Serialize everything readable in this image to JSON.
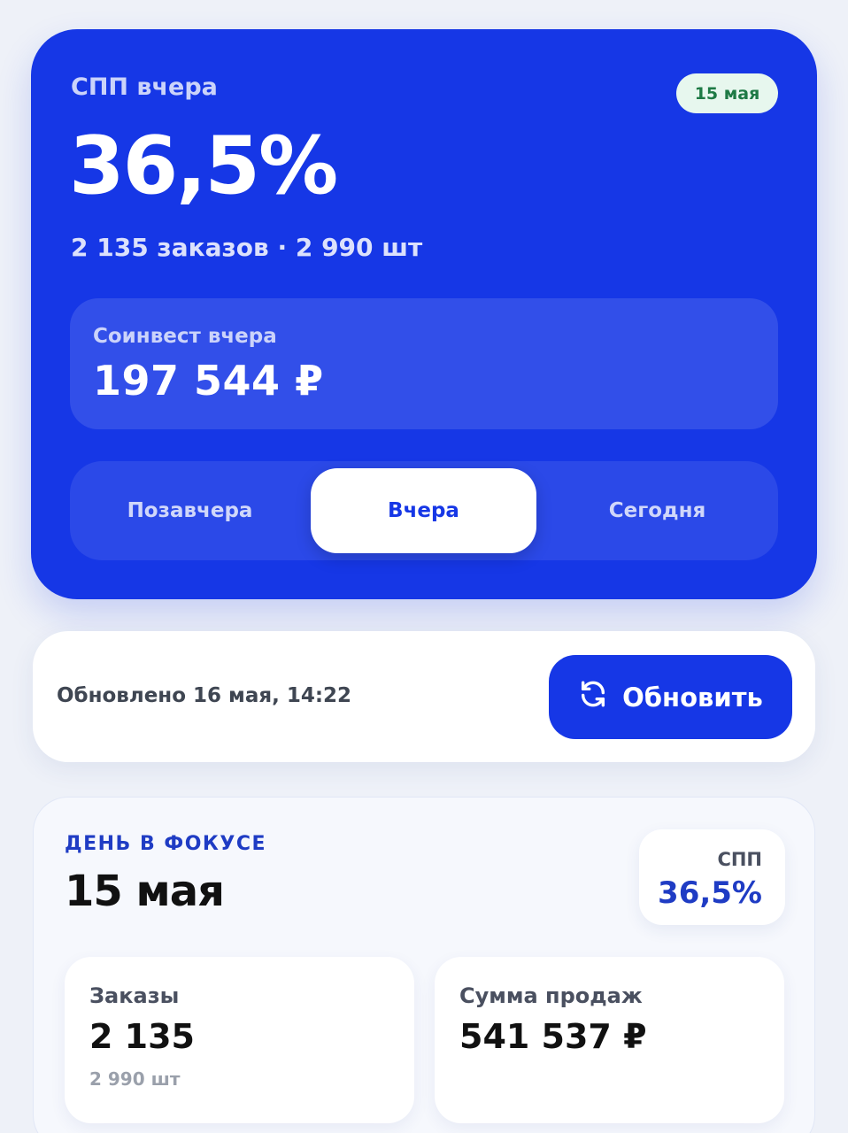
{
  "hero": {
    "label": "СПП вчера",
    "date_badge": "15 мая",
    "value": "36,5%",
    "subtitle": "2 135 заказов · 2 990 шт",
    "coinvest": {
      "label": "Соинвест вчера",
      "value": "197 544 ₽"
    },
    "tabs": [
      "Позавчера",
      "Вчера",
      "Сегодня"
    ],
    "selected_tab": "Вчера"
  },
  "update": {
    "text": "Обновлено 16 мая, 14:22",
    "button_label": "Обновить"
  },
  "focus": {
    "kicker": "ДЕНЬ В ФОКУСЕ",
    "date": "15 мая",
    "spp": {
      "label": "СПП",
      "value": "36,5%"
    },
    "orders": {
      "label": "Заказы",
      "value": "2 135",
      "sub": "2 990 шт"
    },
    "sales": {
      "label": "Сумма продаж",
      "value": "541 537 ₽"
    }
  },
  "colors": {
    "accent": "#1637e6",
    "badge_bg": "#e7f7ee",
    "badge_text": "#1e7a45",
    "focus_accent": "#1f3cc4"
  },
  "icons": {
    "refresh": "refresh-icon"
  }
}
